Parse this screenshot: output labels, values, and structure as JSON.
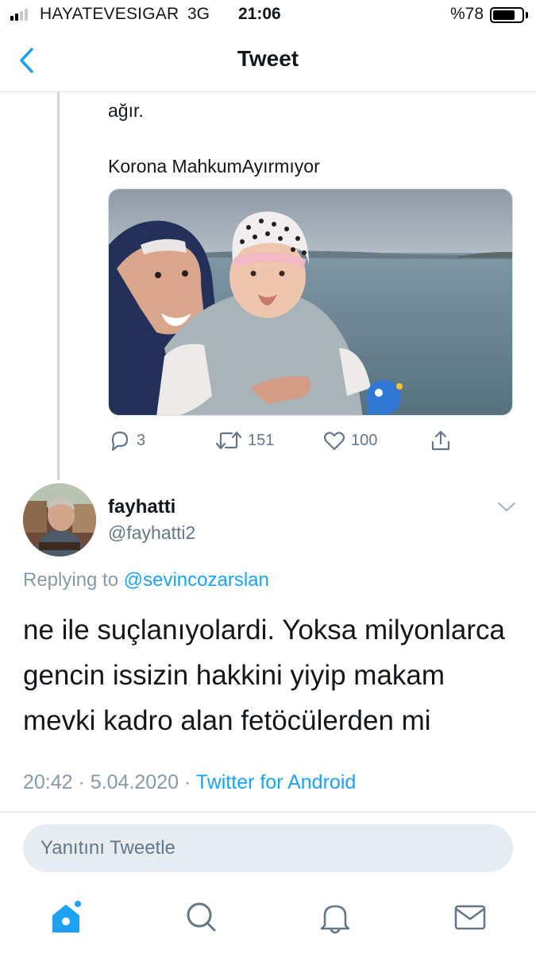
{
  "status_bar": {
    "carrier": "HAYATEVESIGAR",
    "network": "3G",
    "time": "21:06",
    "battery": "%78",
    "battery_level": 0.78
  },
  "nav": {
    "title": "Tweet",
    "back_icon": "chevron-left-icon"
  },
  "previous_tweet": {
    "text_line": "ağır.",
    "hashtag_line": "Korona MahkumAyırmıyor",
    "photo_alt": "photo",
    "actions": {
      "replies": "3",
      "retweets": "151",
      "likes": "100"
    }
  },
  "tweet": {
    "display_name": "fayhatti",
    "handle": "@fayhatti2",
    "replying_prefix": "Replying to",
    "replying_to": "@sevincozarslan",
    "body_lines": [
      "ne ile suçlanıyolardi. Yoksa milyonlarca",
      "gencin issizin hakkini yiyip makam",
      "mevki kadro alan fetöcülerden mi"
    ],
    "time": "20:42",
    "date": "5.04.2020",
    "separator": "·",
    "source": "Twitter for Android"
  },
  "reply_box": {
    "placeholder": "Yanıtını Tweetle"
  },
  "tab_bar": {
    "items": [
      "home-icon",
      "search-icon",
      "notifications-icon",
      "messages-icon"
    ]
  },
  "colors": {
    "accent": "#1da1f2",
    "secondary_text": "#8899a6",
    "reply_box_bg": "#e6ecf0"
  }
}
